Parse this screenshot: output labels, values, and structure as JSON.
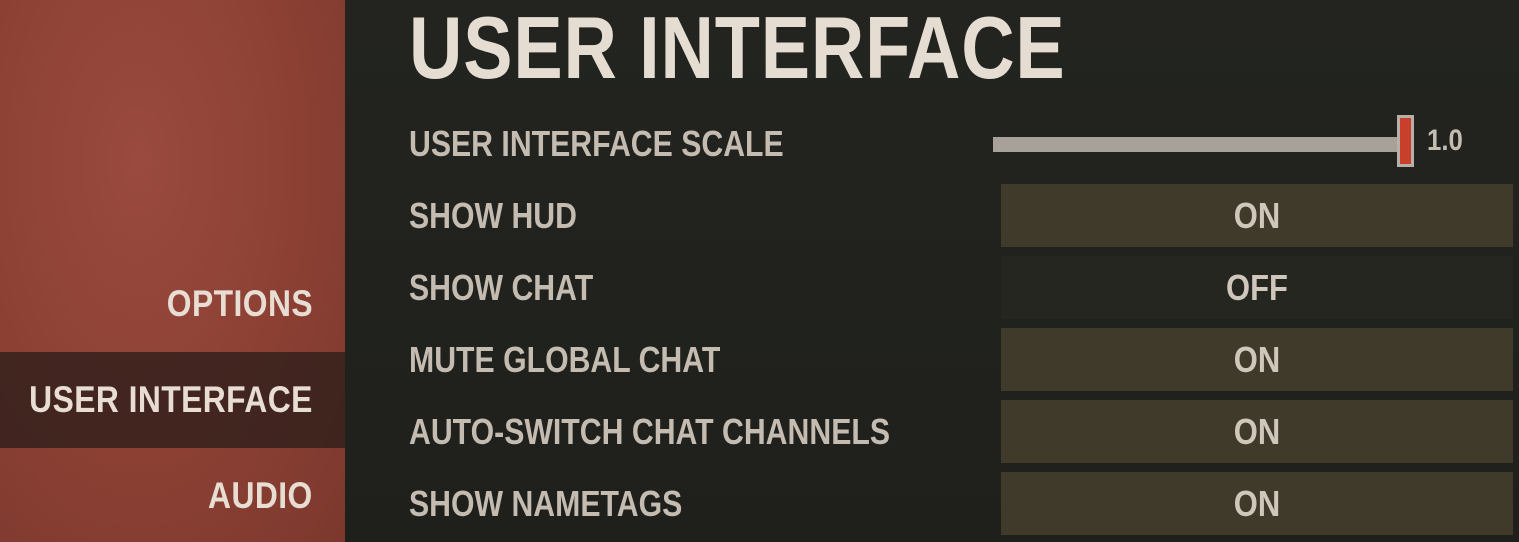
{
  "sidebar": {
    "items": [
      {
        "label": "OPTIONS",
        "active": false
      },
      {
        "label": "USER INTERFACE",
        "active": true
      },
      {
        "label": "AUDIO",
        "active": false
      }
    ]
  },
  "main": {
    "title": "USER INTERFACE",
    "scale": {
      "label": "USER INTERFACE SCALE",
      "value": "1.0",
      "fraction": 1.0
    },
    "rows": [
      {
        "label": "SHOW HUD",
        "value": "ON"
      },
      {
        "label": "SHOW CHAT",
        "value": "OFF"
      },
      {
        "label": "MUTE GLOBAL CHAT",
        "value": "ON"
      },
      {
        "label": "AUTO-SWITCH CHAT CHANNELS",
        "value": "ON"
      },
      {
        "label": "SHOW NAMETAGS",
        "value": "ON"
      }
    ]
  },
  "colors": {
    "accent": "#c8402c",
    "sidebar": "#8c4034",
    "toggle_on": "#403a2a",
    "toggle_off": "#262620"
  }
}
